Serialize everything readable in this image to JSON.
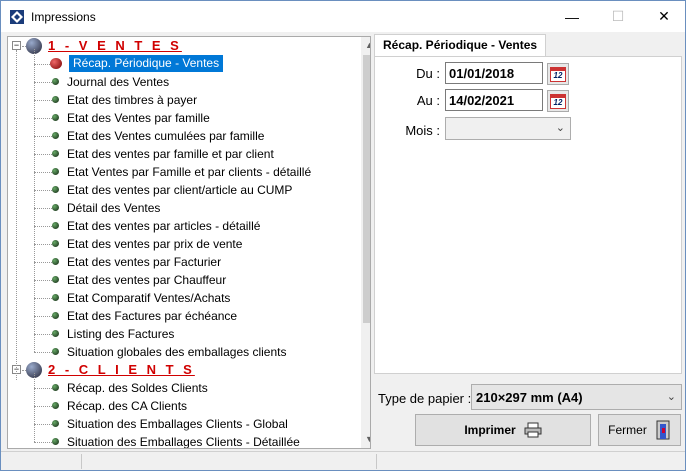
{
  "window": {
    "title": "Impressions",
    "minimize": "—",
    "maximize": "☐",
    "close": "✕"
  },
  "tree": {
    "sections": [
      {
        "title": "1 - V E N T E S",
        "items": [
          "Récap. Périodique - Ventes",
          "Journal des Ventes",
          "Etat des timbres à payer",
          "Etat des Ventes par famille",
          "Etat des Ventes cumulées par famille",
          "Etat des ventes par famille et par client",
          "Etat Ventes par Famille et par clients - détaillé",
          "Etat des ventes par client/article au CUMP",
          "Détail des Ventes",
          "Etat des ventes par articles - détaillé",
          "Etat des ventes par prix de vente",
          "Etat des ventes par Facturier",
          "Etat des ventes par Chauffeur",
          "Etat Comparatif Ventes/Achats",
          "Etat des Factures par échéance",
          "Listing des Factures",
          "Situation globales des emballages clients"
        ]
      },
      {
        "title": "2 - C L I E N T S",
        "items": [
          "Récap. des Soldes Clients",
          "Récap. des CA Clients",
          "Situation des Emballages Clients - Global",
          "Situation des Emballages Clients - Détaillée"
        ]
      }
    ],
    "selected_index": 0,
    "scroll_up": "▲",
    "scroll_down": "▼"
  },
  "panel": {
    "tab_label": "Récap. Périodique - Ventes",
    "du_label": "Du :",
    "du_value": "01/01/2018",
    "au_label": "Au :",
    "au_value": "14/02/2021",
    "mois_label": "Mois :",
    "mois_value": "",
    "calendar_icon_text": "12"
  },
  "footer": {
    "paper_label": "Type de papier :",
    "paper_value": "210×297 mm (A4)",
    "print_button": "Imprimer",
    "close_button": "Fermer"
  },
  "colors": {
    "section_title": "#d00000",
    "selection": "#0078d7"
  }
}
